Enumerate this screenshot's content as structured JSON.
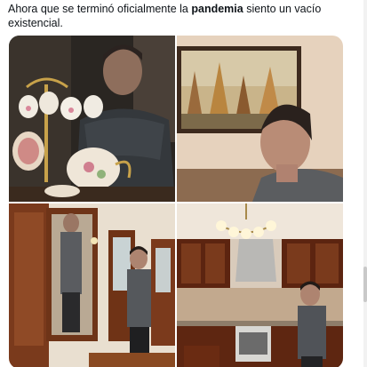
{
  "post": {
    "text_before": "Ahora que se terminó oficialmente la ",
    "text_bold": "pandemia",
    "text_after": " siento un vacío existencial."
  },
  "media": {
    "photo_count": 4
  },
  "colors": {
    "text": "#0f1419",
    "background": "#ffffff"
  }
}
